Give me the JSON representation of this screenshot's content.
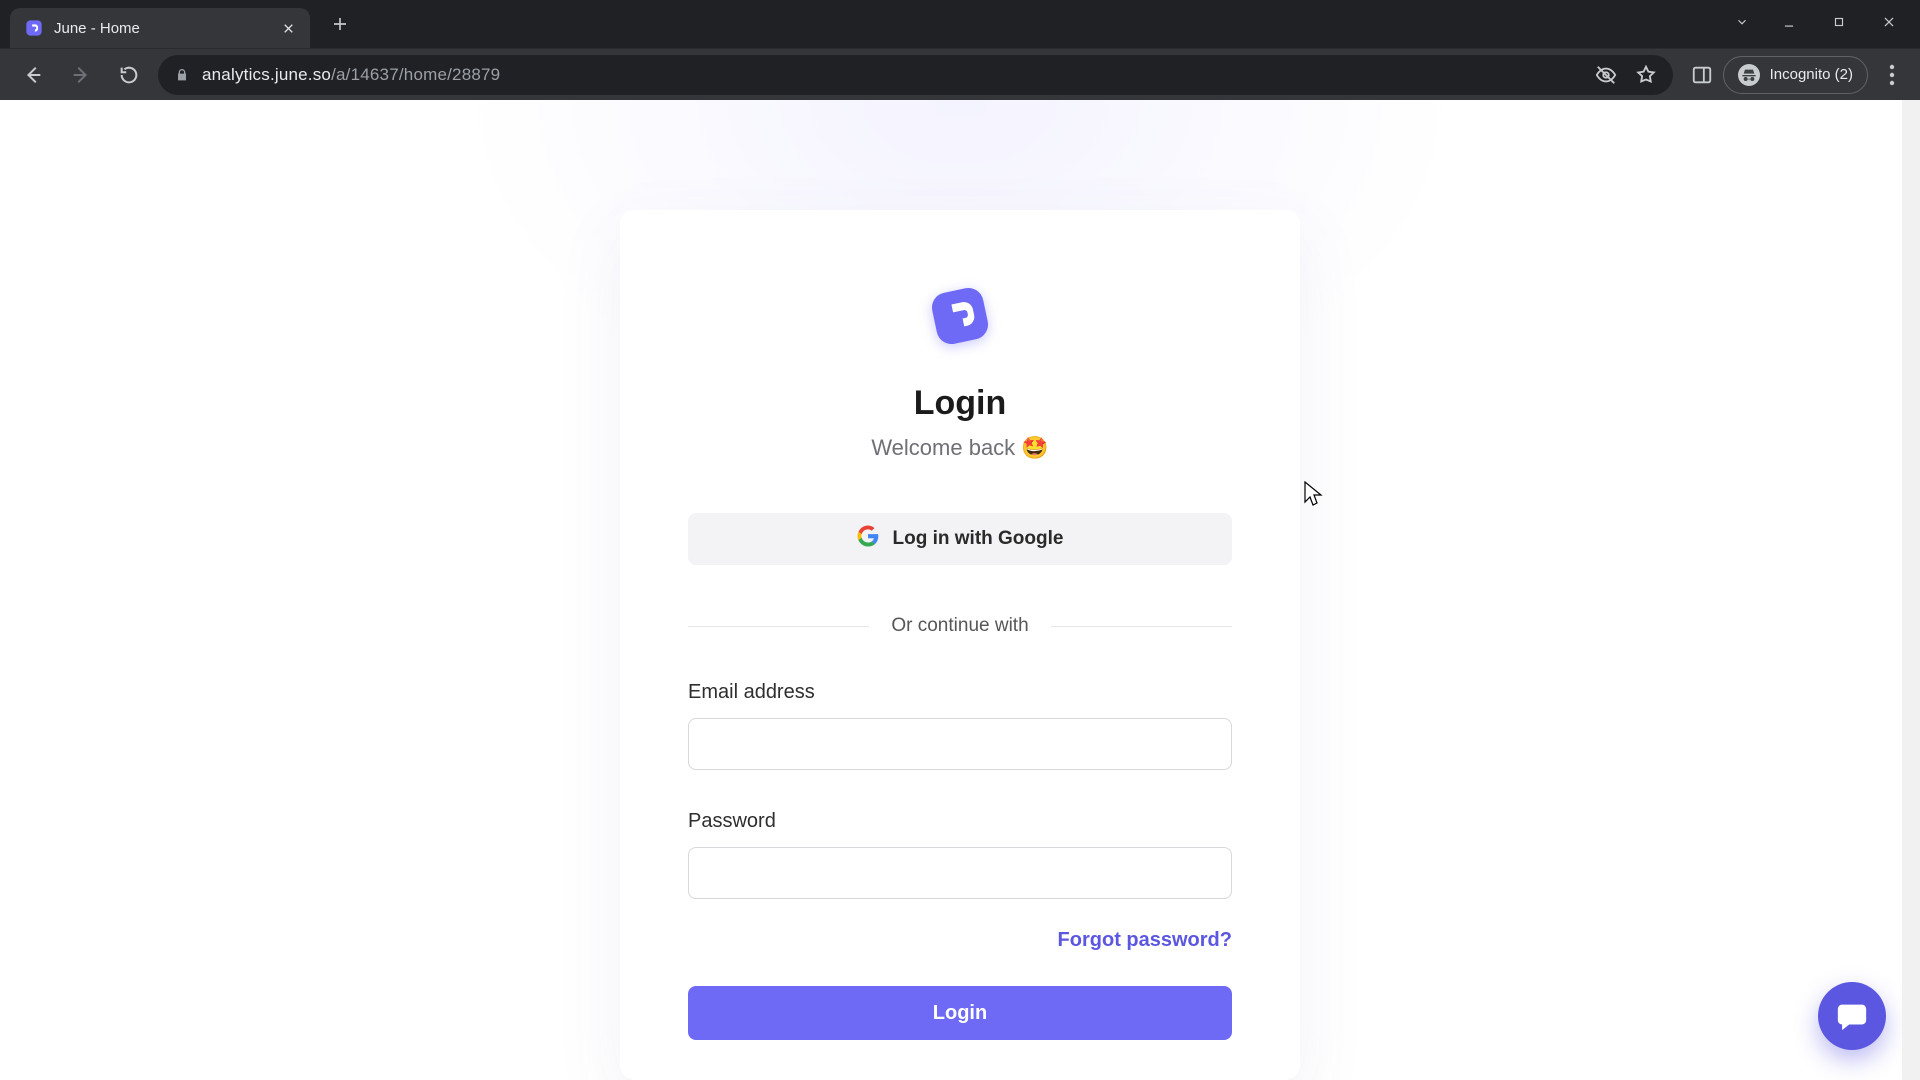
{
  "browser": {
    "tab_title": "June - Home",
    "url_host": "analytics.june.so",
    "url_path": "/a/14637/home/28879",
    "incognito_label": "Incognito (2)"
  },
  "login": {
    "heading": "Login",
    "subtitle": "Welcome back 🤩",
    "google_label": "Log in with Google",
    "divider": "Or continue with",
    "email_label": "Email address",
    "password_label": "Password",
    "forgot": "Forgot password?",
    "submit": "Login"
  },
  "colors": {
    "accent": "#6e6af5"
  }
}
